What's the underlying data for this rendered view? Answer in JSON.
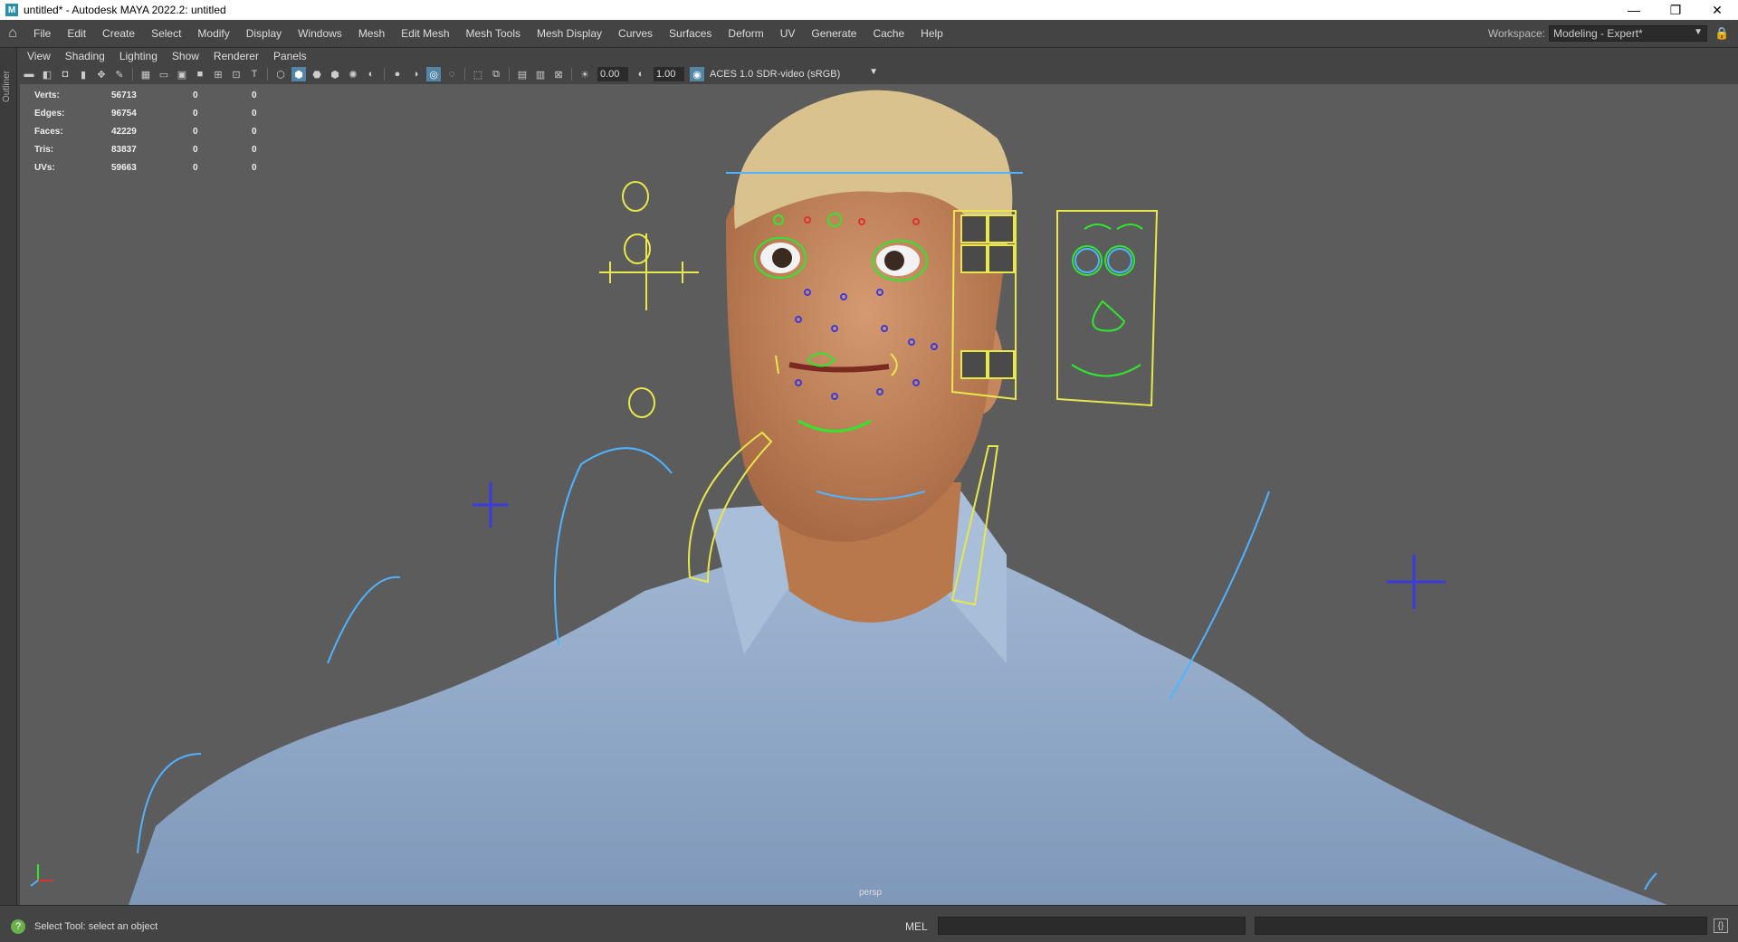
{
  "window": {
    "title": "untitled* - Autodesk MAYA 2022.2: untitled",
    "app_icon": "M",
    "controls": [
      "minimize-icon",
      "restore-icon",
      "close-icon"
    ],
    "control_glyphs": [
      "—",
      "❐",
      "✕"
    ]
  },
  "menubar": {
    "items": [
      "File",
      "Edit",
      "Create",
      "Select",
      "Modify",
      "Display",
      "Windows",
      "Mesh",
      "Edit Mesh",
      "Mesh Tools",
      "Mesh Display",
      "Curves",
      "Surfaces",
      "Deform",
      "UV",
      "Generate",
      "Cache",
      "Help"
    ],
    "workspace_label": "Workspace:",
    "workspace_value": "Modeling - Expert*"
  },
  "outliner": {
    "label": "Outliner"
  },
  "panel_menu": {
    "items": [
      "View",
      "Shading",
      "Lighting",
      "Show",
      "Renderer",
      "Panels"
    ]
  },
  "panel_toolbar": {
    "exposure": "0.00",
    "gamma": "1.00",
    "color_space": "ACES 1.0 SDR-video (sRGB)"
  },
  "hud": {
    "rows": [
      {
        "label": "Verts:",
        "v1": "56713",
        "v2": "0",
        "v3": "0"
      },
      {
        "label": "Edges:",
        "v1": "96754",
        "v2": "0",
        "v3": "0"
      },
      {
        "label": "Faces:",
        "v1": "42229",
        "v2": "0",
        "v3": "0"
      },
      {
        "label": "Tris:",
        "v1": "83837",
        "v2": "0",
        "v3": "0"
      },
      {
        "label": "UVs:",
        "v1": "59663",
        "v2": "0",
        "v3": "0"
      }
    ]
  },
  "viewport": {
    "camera": "persp",
    "background": "#5c5c5c",
    "rig_colors": {
      "yellow": "#e8e84a",
      "blue": "#4fb3ff",
      "dark_blue": "#3a3adf",
      "green": "#2ee82e",
      "red": "#e03030"
    },
    "skin_color": "#c98a60",
    "shirt_color": "#8fa8c8",
    "hair_color": "#d8c08a"
  },
  "statusbar": {
    "help_text": "Select Tool: select an object",
    "mel_label": "MEL"
  }
}
